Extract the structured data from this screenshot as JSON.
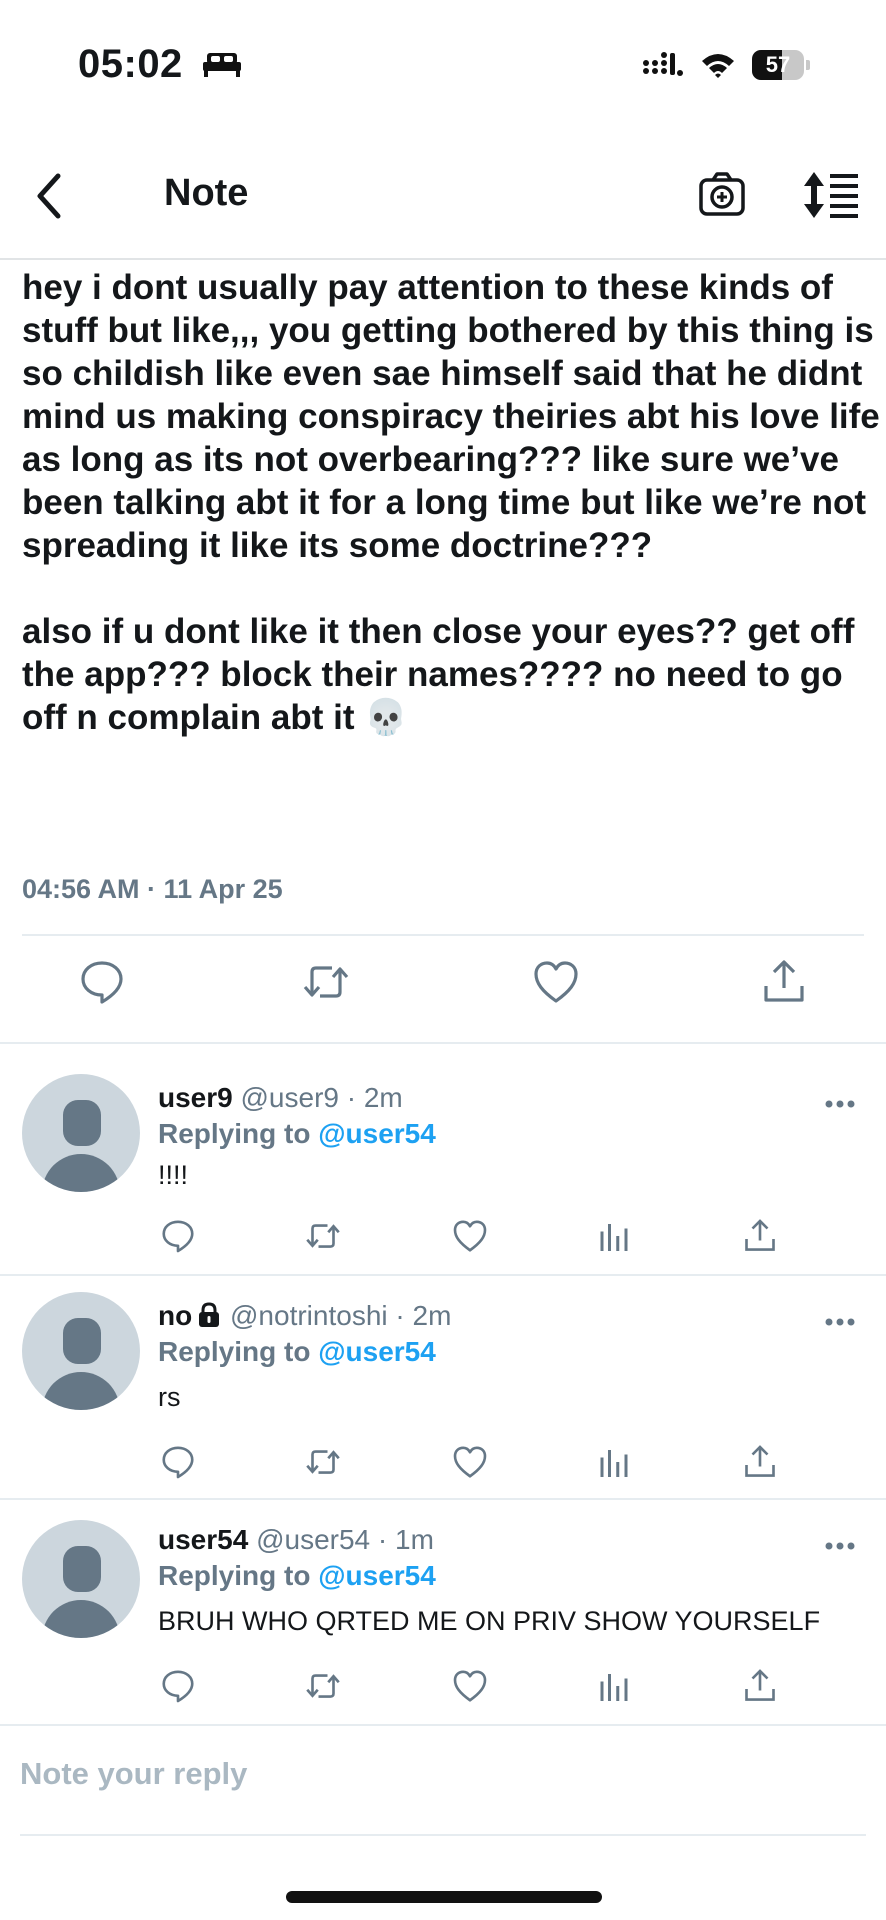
{
  "status_bar": {
    "time": "05:02",
    "battery": "57",
    "battery_level": 0.57
  },
  "header": {
    "title": "Note"
  },
  "main_tweet": {
    "text": "hey i dont usually pay attention to these kinds of stuff but like,,, you getting bothered by this thing is so childish like even sae himself said that he didnt mind us making conspiracy theiries abt his love life as long as its not overbearing??? like sure we’ve been talking abt it for a long time but like we’re not spreading it like its some doctrine???\n\nalso if u dont like it then close your eyes?? get off the app??? block their names???? no need to go off n complain abt it 💀",
    "timestamp": "04:56 AM · 11 Apr 25"
  },
  "replies": [
    {
      "name": "user9",
      "handle": "@user9 · 2m",
      "replying_label": "Replying to",
      "replying_to": "@user54",
      "body": "!!!!",
      "locked": false
    },
    {
      "name": "no",
      "handle": "@notrintoshi · 2m",
      "replying_label": "Replying to",
      "replying_to": "@user54",
      "body": "rs",
      "locked": true
    },
    {
      "name": "user54",
      "handle": "@user54 · 1m",
      "replying_label": "Replying to",
      "replying_to": "@user54",
      "body": "BRUH WHO QRTED ME ON PRIV SHOW YOURSELF",
      "locked": false
    }
  ],
  "composer": {
    "placeholder": "Note your reply"
  },
  "icons": {
    "back": "chevron-left-icon",
    "camera": "camera-icon",
    "sort": "sort-icon",
    "reply": "reply-icon",
    "retweet": "retweet-icon",
    "like": "heart-icon",
    "analytics": "analytics-icon",
    "share": "share-icon",
    "more": "more-icon",
    "lock": "lock-icon"
  },
  "colors": {
    "accent": "#1da1f2",
    "secondary_text": "#657786",
    "divider": "#e6ecf0",
    "avatar_bg": "#ccd6dd"
  }
}
